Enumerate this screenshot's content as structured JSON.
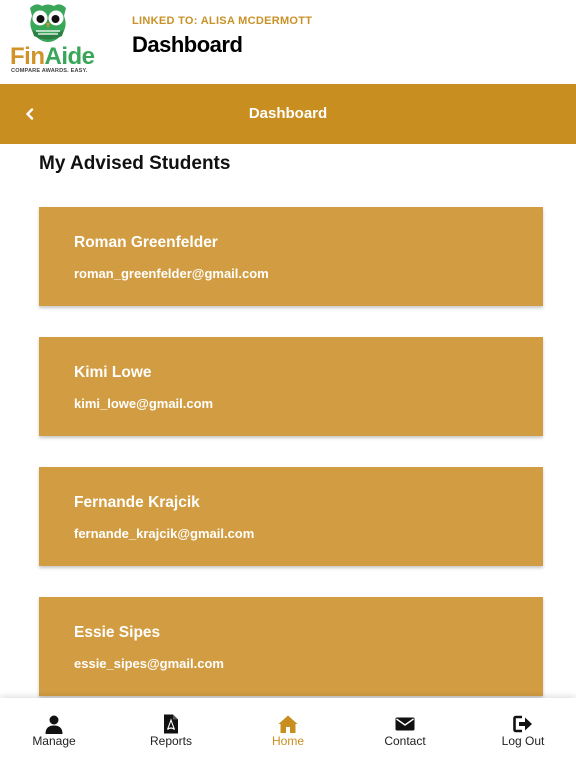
{
  "header": {
    "logo": {
      "brand_prefix": "Fin",
      "brand_suffix": "Aide",
      "tagline": "COMPARE AWARDS. EASY."
    },
    "linked_label": "LINKED TO: ALISA MCDERMOTT",
    "title": "Dashboard"
  },
  "navbar": {
    "title": "Dashboard",
    "back_icon": "chevron-left-icon"
  },
  "main": {
    "section_title": "My Advised Students",
    "students": [
      {
        "name": "Roman Greenfelder",
        "email": "roman_greenfelder@gmail.com"
      },
      {
        "name": "Kimi Lowe",
        "email": "kimi_lowe@gmail.com"
      },
      {
        "name": "Fernande Krajcik",
        "email": "fernande_krajcik@gmail.com"
      },
      {
        "name": "Essie Sipes",
        "email": "essie_sipes@gmail.com"
      }
    ]
  },
  "tabbar": {
    "active": "Home",
    "tabs": [
      {
        "label": "Manage",
        "icon": "user-icon"
      },
      {
        "label": "Reports",
        "icon": "pdf-file-icon"
      },
      {
        "label": "Home",
        "icon": "home-icon"
      },
      {
        "label": "Contact",
        "icon": "envelope-icon"
      },
      {
        "label": "Log Out",
        "icon": "sign-out-icon"
      }
    ]
  },
  "colors": {
    "accent": "#c98e20",
    "card": "#d29d42",
    "brand_orange": "#d0932a",
    "brand_green": "#3aa65a"
  }
}
